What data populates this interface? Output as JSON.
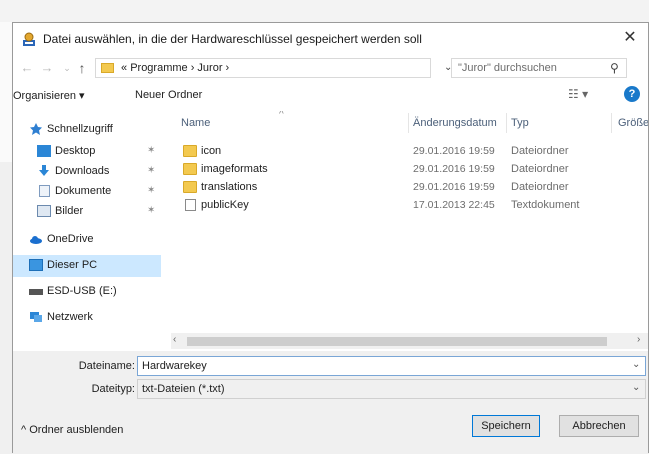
{
  "dialog": {
    "title": "Datei auswählen, in die der Hardwareschlüssel gespeichert werden soll",
    "close_label": "✕"
  },
  "nav": {
    "address_prefix": "«",
    "address_crumbs": "Programme  ›  Juror  ›",
    "search_placeholder": "\"Juror\" durchsuchen"
  },
  "toolbar": {
    "organize_label": "Organisieren ▾",
    "new_folder_label": "Neuer Ordner",
    "view_label": "☷ ▾",
    "help_label": "?"
  },
  "sidebar": {
    "items": [
      {
        "label": "Schnellzugriff",
        "icon": "star-icon",
        "pinned": false
      },
      {
        "label": "Desktop",
        "icon": "desktop-icon",
        "pinned": true
      },
      {
        "label": "Downloads",
        "icon": "download-icon",
        "pinned": true
      },
      {
        "label": "Dokumente",
        "icon": "documents-icon",
        "pinned": true
      },
      {
        "label": "Bilder",
        "icon": "pictures-icon",
        "pinned": true
      },
      {
        "label": "OneDrive",
        "icon": "cloud-icon",
        "pinned": false
      },
      {
        "label": "Dieser PC",
        "icon": "computer-icon",
        "pinned": false
      },
      {
        "label": "ESD-USB (E:)",
        "icon": "drive-icon",
        "pinned": false
      },
      {
        "label": "Netzwerk",
        "icon": "network-icon",
        "pinned": false
      }
    ],
    "selected": "Dieser PC"
  },
  "file_list": {
    "columns": [
      "Name",
      "Änderungsdatum",
      "Typ",
      "Größe"
    ],
    "rows": [
      {
        "name": "icon",
        "date": "29.01.2016 19:59",
        "type": "Dateiordner",
        "kind": "folder"
      },
      {
        "name": "imageformats",
        "date": "29.01.2016 19:59",
        "type": "Dateiordner",
        "kind": "folder"
      },
      {
        "name": "translations",
        "date": "29.01.2016 19:59",
        "type": "Dateiordner",
        "kind": "folder"
      },
      {
        "name": "publicKey",
        "date": "17.01.2013 22:45",
        "type": "Textdokument",
        "kind": "document"
      }
    ]
  },
  "form": {
    "filename_label": "Dateiname:",
    "filename_value": "Hardwarekey",
    "filetype_label": "Dateityp:",
    "filetype_value": "txt-Dateien (*.txt)"
  },
  "footer": {
    "hide_folders_label": "Ordner ausblenden",
    "save_label": "Speichern",
    "cancel_label": "Abbrechen"
  },
  "colors": {
    "accent": "#0078d7",
    "selection": "#cce8ff",
    "folder": "#f3c94f"
  }
}
